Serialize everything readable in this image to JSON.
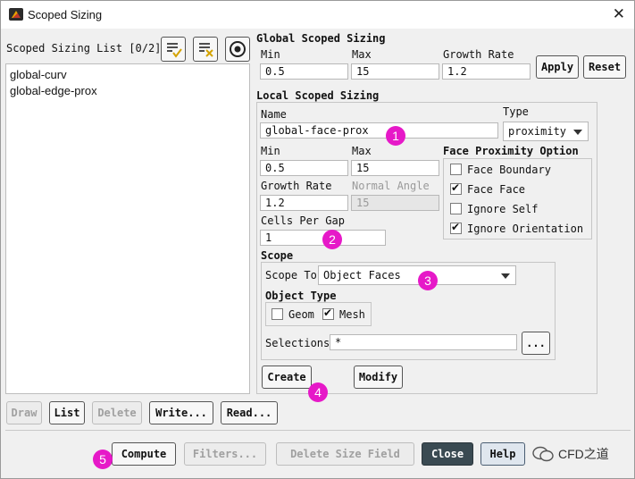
{
  "window": {
    "title": "Scoped Sizing",
    "close_glyph": "✕"
  },
  "left": {
    "list_header": "Scoped Sizing List [0/2]",
    "items": [
      "global-curv",
      "global-edge-prox"
    ],
    "toolbar_icons": [
      "select-all-icon",
      "deselect-all-icon",
      "target-icon"
    ]
  },
  "global": {
    "heading": "Global Scoped Sizing",
    "min_label": "Min",
    "min_value": "0.5",
    "max_label": "Max",
    "max_value": "15",
    "growth_label": "Growth Rate",
    "growth_value": "1.2",
    "apply": "Apply",
    "reset": "Reset"
  },
  "local": {
    "heading": "Local Scoped Sizing",
    "name_label": "Name",
    "name_value": "global-face-prox",
    "type_label": "Type",
    "type_value": "proximity",
    "min_label": "Min",
    "min_value": "0.5",
    "max_label": "Max",
    "max_value": "15",
    "growth_label": "Growth Rate",
    "growth_value": "1.2",
    "normal_angle_label": "Normal Angle",
    "normal_angle_value": "15",
    "cells_label": "Cells Per Gap",
    "cells_value": "1",
    "fpo_heading": "Face Proximity Option",
    "fpo": [
      {
        "label": "Face Boundary",
        "checked": false
      },
      {
        "label": "Face Face",
        "checked": true
      },
      {
        "label": "Ignore Self",
        "checked": false
      },
      {
        "label": "Ignore Orientation",
        "checked": true
      }
    ],
    "scope_heading": "Scope",
    "scope_to_label": "Scope To",
    "scope_to_value": "Object Faces",
    "object_type_heading": "Object Type",
    "geom_label": "Geom",
    "geom_checked": false,
    "mesh_label": "Mesh",
    "mesh_checked": true,
    "selections_label": "Selections",
    "selections_value": "*",
    "browse": "...",
    "create": "Create",
    "modify": "Modify"
  },
  "list_buttons": {
    "draw": "Draw",
    "list": "List",
    "delete": "Delete",
    "write": "Write...",
    "read": "Read..."
  },
  "bottom_buttons": {
    "compute": "Compute",
    "filters": "Filters...",
    "delete_size_field": "Delete Size Field",
    "close": "Close",
    "help": "Help"
  },
  "badges": [
    "1",
    "2",
    "3",
    "4",
    "5"
  ],
  "watermark": "CFD之道",
  "colors": {
    "badge": "#e619c8",
    "close_button": "#3a4a52"
  }
}
